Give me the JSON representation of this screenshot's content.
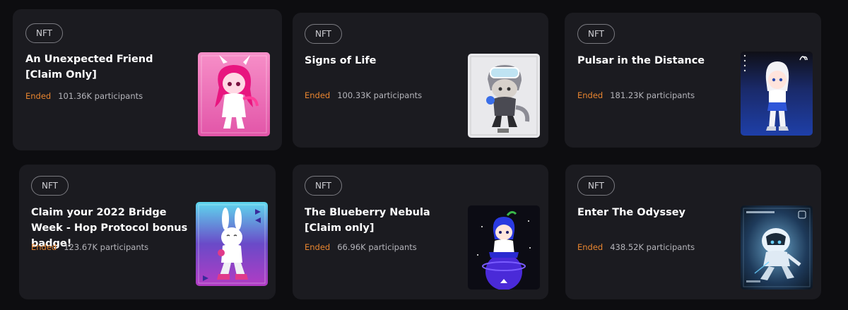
{
  "cards": [
    {
      "tag": "NFT",
      "title": "An Unexpected Friend [Claim Only]",
      "status": "Ended",
      "participants": "101.36K participants",
      "thumb_icon": "pink-anime-character-image"
    },
    {
      "tag": "NFT",
      "title": "Signs of Life",
      "status": "Ended",
      "participants": "100.33K participants",
      "thumb_icon": "goggles-character-image"
    },
    {
      "tag": "NFT",
      "title": "Pulsar in the Distance",
      "status": "Ended",
      "participants": "181.23K participants",
      "thumb_icon": "blue-anime-character-image"
    },
    {
      "tag": "NFT",
      "title": "Claim your 2022 Bridge Week - Hop Protocol bonus badge!",
      "status": "Ended",
      "participants": "123.67K participants",
      "thumb_icon": "bunny-character-image"
    },
    {
      "tag": "NFT",
      "title": "The Blueberry Nebula [Claim only]",
      "status": "Ended",
      "participants": "66.96K participants",
      "thumb_icon": "blueberry-character-image"
    },
    {
      "tag": "NFT",
      "title": "Enter The Odyssey",
      "status": "Ended",
      "participants": "438.52K participants",
      "thumb_icon": "astronaut-character-image"
    }
  ],
  "colors": {
    "background": "#0d0d10",
    "card": "#1b1b20",
    "status_ended": "#e8852f",
    "text_secondary": "#b5b5bb"
  }
}
